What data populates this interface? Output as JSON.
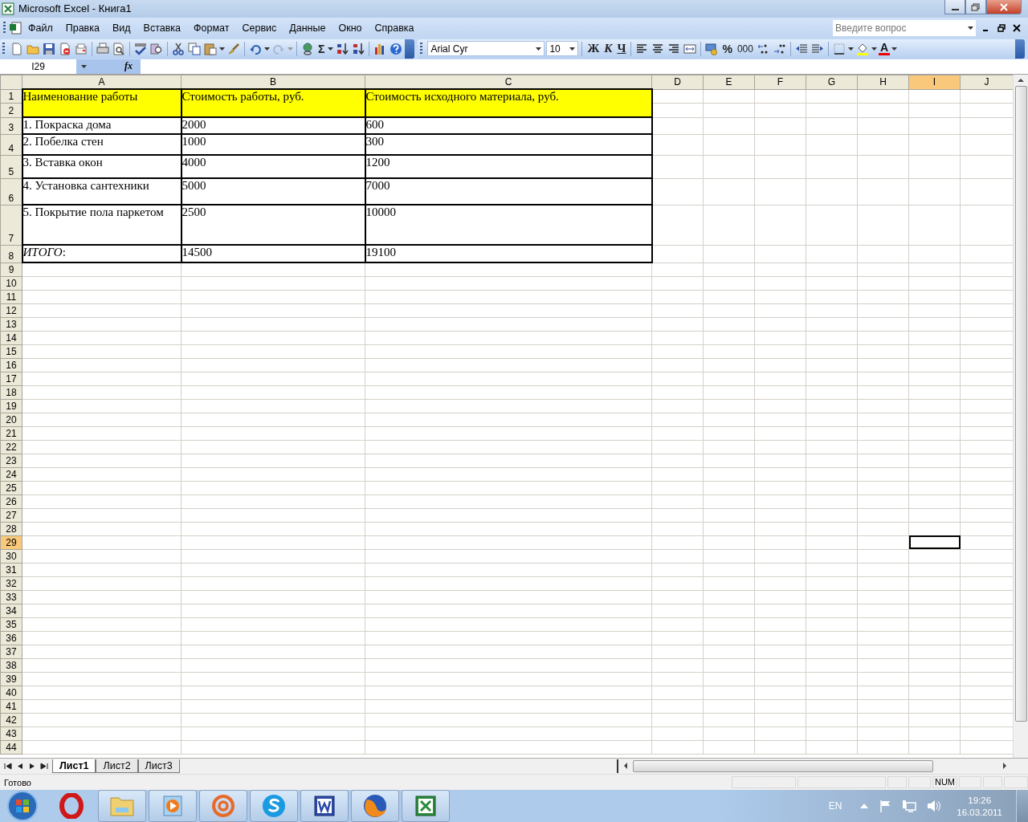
{
  "window": {
    "title": "Microsoft Excel - Книга1"
  },
  "menu": [
    "Файл",
    "Правка",
    "Вид",
    "Вставка",
    "Формат",
    "Сервис",
    "Данные",
    "Окно",
    "Справка"
  ],
  "help_search": {
    "placeholder": "Введите вопрос"
  },
  "toolbar": {
    "sum": "Σ",
    "font": "Arial Cyr",
    "size": "10",
    "bold": "Ж",
    "italic": "К",
    "underline": "Ч",
    "percent": "%",
    "thousands": "000",
    "font_color": "A"
  },
  "formula_bar": {
    "name_box": "I29",
    "fx": "fx"
  },
  "columns": [
    {
      "label": "A",
      "selected": false
    },
    {
      "label": "B",
      "selected": false
    },
    {
      "label": "C",
      "selected": false
    },
    {
      "label": "D",
      "selected": false
    },
    {
      "label": "E",
      "selected": false
    },
    {
      "label": "F",
      "selected": false
    },
    {
      "label": "G",
      "selected": false
    },
    {
      "label": "H",
      "selected": false
    },
    {
      "label": "I",
      "selected": true
    },
    {
      "label": "J",
      "selected": false
    }
  ],
  "rows": [
    {
      "label": "1",
      "selected": false,
      "cells": [
        "Наименование работы",
        "Стоимость работы, руб.",
        "Стоимость исходного материала, руб."
      ]
    },
    {
      "label": "2",
      "selected": false
    },
    {
      "label": "3",
      "selected": false,
      "cells": [
        "1. Покраска дома",
        "2000",
        "600"
      ]
    },
    {
      "label": "4",
      "selected": false,
      "cells": [
        "2. Побелка стен",
        "1000",
        "300"
      ]
    },
    {
      "label": "5",
      "selected": false,
      "cells": [
        "3. Вставка окон",
        "4000",
        "1200"
      ]
    },
    {
      "label": "6",
      "selected": false,
      "cells": [
        "4. Установка сантехники",
        "5000",
        "7000"
      ]
    },
    {
      "label": "7",
      "selected": false,
      "cells": [
        "5. Покрытие пола паркетом",
        "2500",
        "10000"
      ]
    },
    {
      "label": "8",
      "selected": false,
      "cells": [
        "*ИТОГО*:",
        "14500",
        "19100"
      ]
    },
    {
      "label": "9",
      "selected": false
    },
    {
      "label": "10",
      "selected": false
    },
    {
      "label": "11",
      "selected": false
    },
    {
      "label": "12",
      "selected": false
    },
    {
      "label": "13",
      "selected": false
    },
    {
      "label": "14",
      "selected": false
    },
    {
      "label": "15",
      "selected": false
    },
    {
      "label": "16",
      "selected": false
    },
    {
      "label": "17",
      "selected": false
    },
    {
      "label": "18",
      "selected": false
    },
    {
      "label": "19",
      "selected": false
    },
    {
      "label": "20",
      "selected": false
    },
    {
      "label": "21",
      "selected": false
    },
    {
      "label": "22",
      "selected": false
    },
    {
      "label": "23",
      "selected": false
    },
    {
      "label": "24",
      "selected": false
    },
    {
      "label": "25",
      "selected": false
    },
    {
      "label": "26",
      "selected": false
    },
    {
      "label": "27",
      "selected": false
    },
    {
      "label": "28",
      "selected": false
    },
    {
      "label": "29",
      "selected": true
    },
    {
      "label": "30",
      "selected": false
    },
    {
      "label": "31",
      "selected": false
    },
    {
      "label": "32",
      "selected": false
    },
    {
      "label": "33",
      "selected": false
    },
    {
      "label": "34",
      "selected": false
    },
    {
      "label": "35",
      "selected": false
    },
    {
      "label": "36",
      "selected": false
    },
    {
      "label": "37",
      "selected": false
    },
    {
      "label": "38",
      "selected": false
    },
    {
      "label": "39",
      "selected": false
    },
    {
      "label": "40",
      "selected": false
    },
    {
      "label": "41",
      "selected": false
    },
    {
      "label": "42",
      "selected": false
    },
    {
      "label": "43",
      "selected": false
    },
    {
      "label": "44",
      "selected": false
    }
  ],
  "sheet_tabs": [
    {
      "label": "Лист1",
      "selected": true
    },
    {
      "label": "Лист2",
      "selected": false
    },
    {
      "label": "Лист3",
      "selected": false
    }
  ],
  "status_bar": {
    "text": "Готово",
    "indicators": [
      "NUM"
    ]
  },
  "taskbar": {
    "language": "EN",
    "time": "19:26",
    "date": "16.03.2011"
  }
}
